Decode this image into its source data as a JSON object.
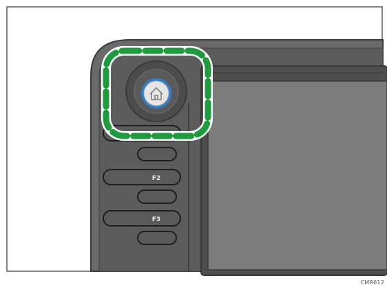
{
  "panel": {
    "buttons": [
      {
        "id": "f1",
        "label": ""
      },
      {
        "id": "f2",
        "label": "F2"
      },
      {
        "id": "f3",
        "label": "F3"
      }
    ]
  },
  "home_button": {
    "icon": "home-icon"
  },
  "highlight": {
    "color": "#1e9b3c",
    "style": "dashed rounded square"
  },
  "caption": "CMR612",
  "colors": {
    "frame": "#666666",
    "panel": "#5b5b5b",
    "screen": "#7a7a7a",
    "home_ring": "#2f7fd0",
    "highlight": "#1e9b3c"
  }
}
